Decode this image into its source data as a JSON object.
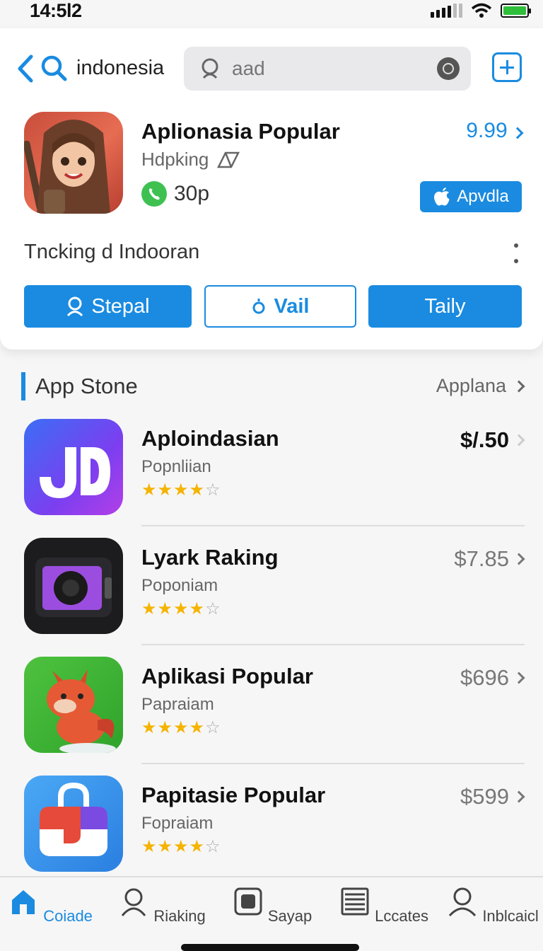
{
  "status_bar": {
    "time": "14:5l2"
  },
  "search": {
    "query": "indonesia",
    "placeholder": "aad"
  },
  "featured": {
    "title": "Aplionasia Popular",
    "subtitle": "Hdpking",
    "size": "30p",
    "price": "9.99",
    "get_label": "Apvdla",
    "description": "Tncking d Indooran",
    "buttons": [
      "Stepal",
      "Vail",
      "Taily"
    ]
  },
  "section": {
    "title": "App Stone",
    "link": "Applana"
  },
  "apps": [
    {
      "name": "Aploindasian",
      "category": "Popnliian",
      "price": "$/.50",
      "rating": 4
    },
    {
      "name": "Lyark Raking",
      "category": "Poponiam",
      "price": "$7.85",
      "rating": 4
    },
    {
      "name": "Aplikasi Popular",
      "category": "Papraiam",
      "price": "$696",
      "rating": 4
    },
    {
      "name": "Papitasie Popular",
      "category": "Fopraiam",
      "price": "$599",
      "rating": 4
    }
  ],
  "tabs": [
    {
      "label": "Coiade",
      "icon": "home-icon",
      "active": true
    },
    {
      "label": "Riaking",
      "icon": "person-icon",
      "active": false
    },
    {
      "label": "Sayap",
      "icon": "square-icon",
      "active": false
    },
    {
      "label": "Lccates",
      "icon": "list-icon",
      "active": false
    },
    {
      "label": "Inblcaicl",
      "icon": "profile-icon",
      "active": false
    }
  ],
  "colors": {
    "accent": "#1a8be0",
    "star": "#f4b400",
    "phone": "#3fc152"
  }
}
